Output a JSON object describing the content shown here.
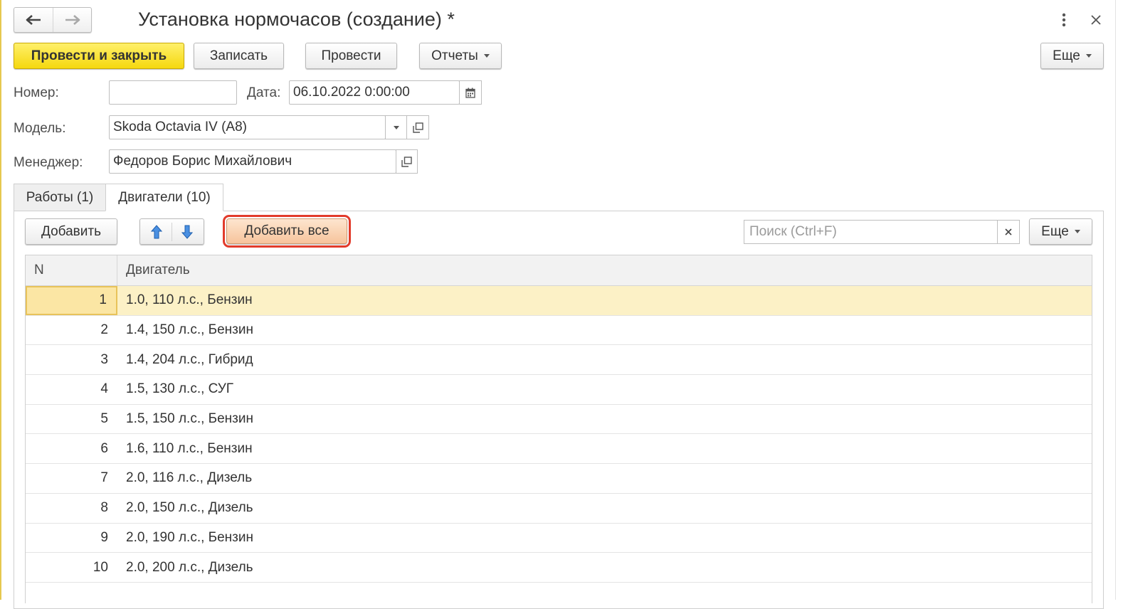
{
  "window": {
    "title": "Установка нормочасов (создание) *",
    "icons": [
      "arrow-left-icon",
      "arrow-right-icon",
      "more-vertical-icon",
      "close-icon"
    ]
  },
  "toolbar": {
    "post_close_label": "Провести и закрыть",
    "save_label": "Записать",
    "post_label": "Провести",
    "reports_label": "Отчеты",
    "more_label": "Еще"
  },
  "form": {
    "number_label": "Номер:",
    "number_value": "",
    "date_label": "Дата:",
    "date_value": "06.10.2022  0:00:00",
    "model_label": "Модель:",
    "model_value": "Skoda Octavia IV (A8)",
    "manager_label": "Менеджер:",
    "manager_value": "Федоров Борис Михайлович"
  },
  "tabs": [
    {
      "label": "Работы (1)",
      "active": false
    },
    {
      "label": "Двигатели (10)",
      "active": true
    }
  ],
  "table_toolbar": {
    "add_label": "Добавить",
    "add_all_label": "Добавить все",
    "search_placeholder": "Поиск (Ctrl+F)",
    "more_label": "Еще"
  },
  "table": {
    "columns": [
      "N",
      "Двигатель"
    ],
    "rows": [
      {
        "n": "1",
        "engine": "1.0, 110 л.с., Бензин",
        "selected": true
      },
      {
        "n": "2",
        "engine": "1.4, 150 л.с., Бензин"
      },
      {
        "n": "3",
        "engine": "1.4, 204 л.с., Гибрид"
      },
      {
        "n": "4",
        "engine": "1.5, 130 л.с., СУГ"
      },
      {
        "n": "5",
        "engine": "1.5, 150 л.с., Бензин"
      },
      {
        "n": "6",
        "engine": "1.6, 110 л.с., Бензин"
      },
      {
        "n": "7",
        "engine": "2.0, 116 л.с., Дизель"
      },
      {
        "n": "8",
        "engine": "2.0, 150 л.с., Дизель"
      },
      {
        "n": "9",
        "engine": "2.0, 190 л.с., Бензин"
      },
      {
        "n": "10",
        "engine": "2.0, 200 л.с., Дизель"
      }
    ]
  },
  "colors": {
    "primary_button": "#f5d80f",
    "highlight_outline": "#e23b2b",
    "selected_row": "#fcf1c6",
    "arrow_blue": "#2f7fd6"
  }
}
